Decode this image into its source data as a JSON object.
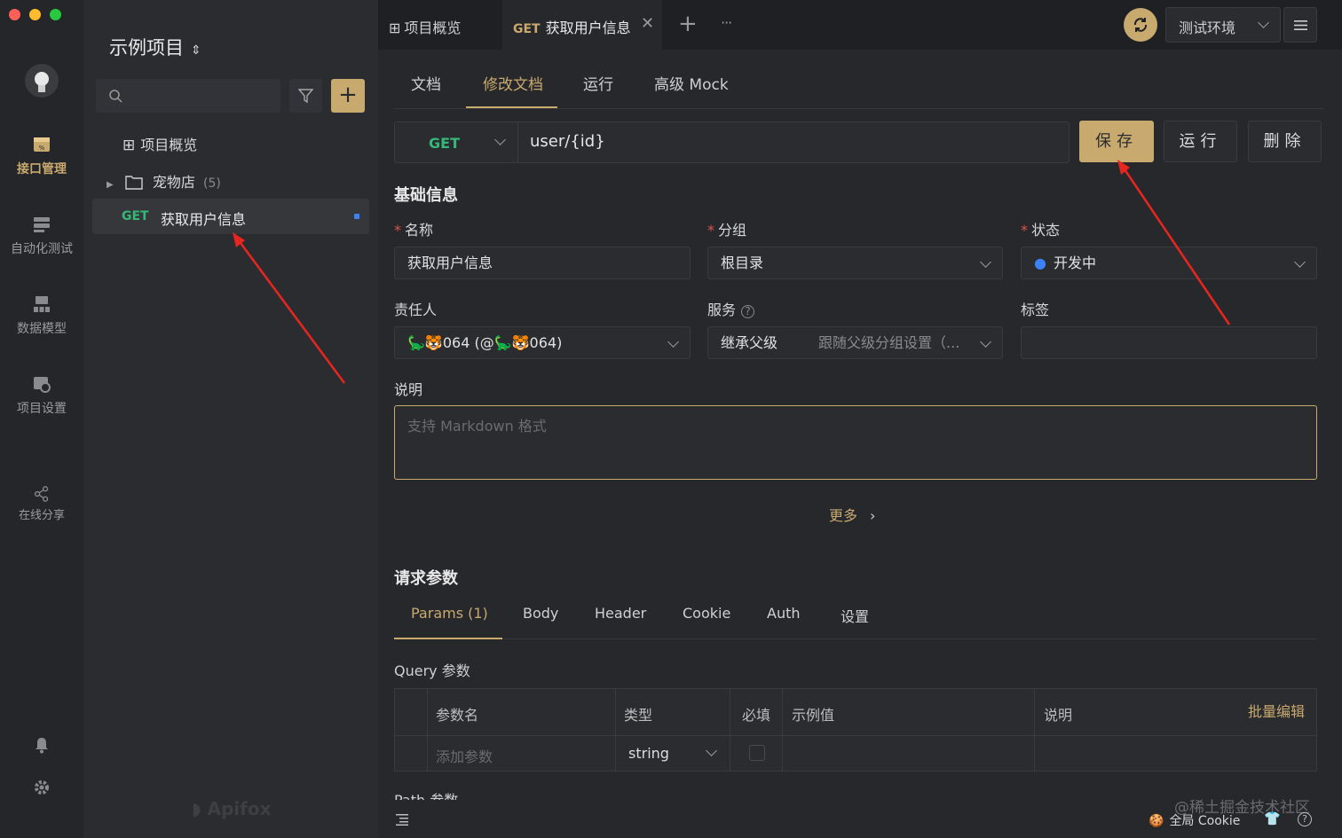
{
  "window": {
    "dots": [
      "#fe5f57",
      "#febc2e",
      "#28c840"
    ]
  },
  "rail": {
    "items": [
      {
        "label": "接口管理",
        "icon": "api-icon",
        "active": true
      },
      {
        "label": "自动化测试",
        "icon": "test-icon"
      },
      {
        "label": "数据模型",
        "icon": "model-icon"
      },
      {
        "label": "项目设置",
        "icon": "settings-icon"
      },
      {
        "label": "在线分享",
        "icon": "share-icon"
      }
    ]
  },
  "sidebar": {
    "project_title": "示例项目",
    "overview": "项目概览",
    "folder": "宠物店",
    "folder_count": "(5)",
    "api_method": "GET",
    "api_name": "获取用户信息",
    "brand": "Apifox"
  },
  "topbar": {
    "tab_overview": "项目概览",
    "tab_method": "GET",
    "tab_name": "获取用户信息",
    "add": "+",
    "more": "···",
    "env": "测试环境"
  },
  "main": {
    "tabs": [
      "文档",
      "修改文档",
      "运行",
      "高级 Mock"
    ],
    "method": "GET",
    "path": "user/{id}",
    "save": "保存",
    "run": "运行",
    "delete": "删除",
    "section_basic": "基础信息",
    "name_label": "名称",
    "name_value": "获取用户信息",
    "group_label": "分组",
    "group_value": "根目录",
    "status_label": "状态",
    "status_value": "开发中",
    "owner_label": "责任人",
    "owner_value": "🦕🐯064 (@🦕🐯064)",
    "service_label": "服务",
    "service_value": "继承父级",
    "service_hint": "跟随父级分组设置（...",
    "tag_label": "标签",
    "desc_label": "说明",
    "desc_placeholder": "支持 Markdown 格式",
    "more": "更多",
    "section_req": "请求参数",
    "req_tabs": [
      "Params (1)",
      "Body",
      "Header",
      "Cookie",
      "Auth",
      "设置"
    ],
    "query_title": "Query 参数",
    "cols": [
      "参数名",
      "类型",
      "必填",
      "示例值",
      "说明"
    ],
    "bulk_edit": "批量编辑",
    "row_placeholder": "添加参数",
    "row_type": "string",
    "path_title": "Path 参数"
  },
  "footer": {
    "cookie": "全局 Cookie",
    "watermark": "@稀土掘金技术社区"
  },
  "colors": {
    "accent": "#c8a96e",
    "get": "#35b779",
    "status": "#3b82f6"
  }
}
